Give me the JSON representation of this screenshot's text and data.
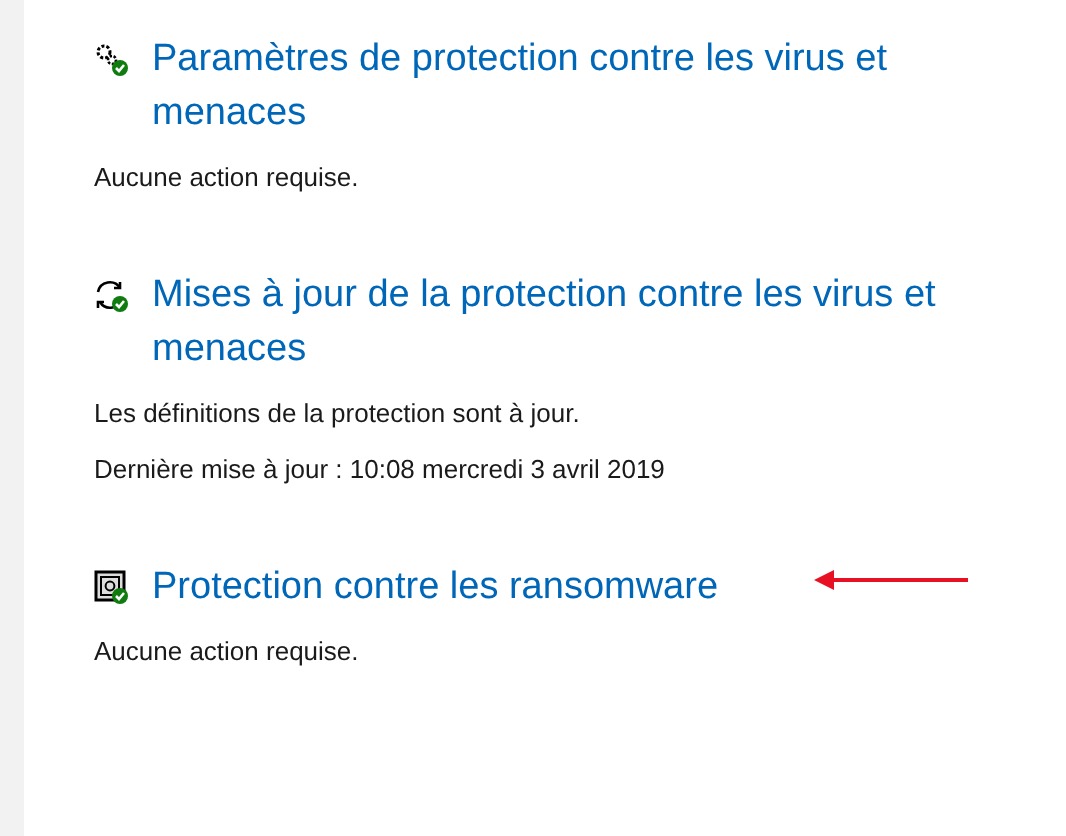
{
  "sections": [
    {
      "kind": "settings",
      "title": "Paramètres de protection contre les virus et menaces",
      "lines": [
        "Aucune action requise."
      ]
    },
    {
      "kind": "updates",
      "title": "Mises à jour de la protection contre les virus et menaces",
      "lines": [
        "Les définitions de la protection sont à jour.",
        "Dernière mise à jour : 10:08 mercredi 3 avril 2019"
      ]
    },
    {
      "kind": "ransomware",
      "title": "Protection contre les ransomware",
      "lines": [
        "Aucune action requise."
      ],
      "arrow": true
    }
  ]
}
